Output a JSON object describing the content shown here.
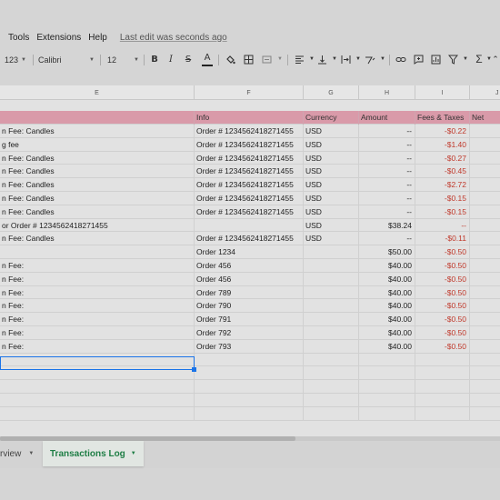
{
  "menu": {
    "items": [
      "Tools",
      "Extensions",
      "Help"
    ],
    "last_edit": "Last edit was seconds ago"
  },
  "toolbar": {
    "number_format": "123",
    "font": "Calibri",
    "font_size": "12",
    "icons": [
      "bold",
      "italic",
      "strikethrough",
      "text-color",
      "fill-color",
      "borders",
      "merge-cells",
      "align-horizontal",
      "align-vertical",
      "text-wrap",
      "text-rotation",
      "insert-link",
      "insert-comment",
      "insert-chart",
      "filter",
      "functions",
      "collapse"
    ]
  },
  "columns": [
    "E",
    "F",
    "G",
    "H",
    "I",
    "J"
  ],
  "header": {
    "e": "",
    "f": "Info",
    "g": "Currency",
    "h": "Amount",
    "i": "Fees & Taxes",
    "j": "Net"
  },
  "rows": [
    {
      "e": "n Fee: Candles",
      "f": "Order # 1234562418271455",
      "g": "USD",
      "h": "--",
      "i": "-$0.22"
    },
    {
      "e": "g fee",
      "f": "Order # 1234562418271455",
      "g": "USD",
      "h": "--",
      "i": "-$1.40"
    },
    {
      "e": "n Fee: Candles",
      "f": "Order # 1234562418271455",
      "g": "USD",
      "h": "--",
      "i": "-$0.27"
    },
    {
      "e": "n Fee: Candles",
      "f": "Order # 1234562418271455",
      "g": "USD",
      "h": "--",
      "i": "-$0.45"
    },
    {
      "e": "n Fee: Candles",
      "f": "Order # 1234562418271455",
      "g": "USD",
      "h": "--",
      "i": "-$2.72"
    },
    {
      "e": "n Fee: Candles",
      "f": "Order # 1234562418271455",
      "g": "USD",
      "h": "--",
      "i": "-$0.15"
    },
    {
      "e": "n Fee: Candles",
      "f": "Order # 1234562418271455",
      "g": "USD",
      "h": "--",
      "i": "-$0.15"
    },
    {
      "e": "or Order # 1234562418271455",
      "f": "",
      "g": "USD",
      "h": "$38.24",
      "i": "--"
    },
    {
      "e": "n Fee: Candles",
      "f": "Order # 1234562418271455",
      "g": "USD",
      "h": "--",
      "i": "-$0.11"
    },
    {
      "e": "",
      "f": "Order 1234",
      "g": "",
      "h": "$50.00",
      "i": "-$0.50"
    },
    {
      "e": "n Fee:",
      "f": "Order 456",
      "g": "",
      "h": "$40.00",
      "i": "-$0.50"
    },
    {
      "e": "n Fee:",
      "f": "Order 456",
      "g": "",
      "h": "$40.00",
      "i": "-$0.50"
    },
    {
      "e": "n Fee:",
      "f": "Order 789",
      "g": "",
      "h": "$40.00",
      "i": "-$0.50"
    },
    {
      "e": "n Fee:",
      "f": "Order 790",
      "g": "",
      "h": "$40.00",
      "i": "-$0.50"
    },
    {
      "e": "n Fee:",
      "f": "Order 791",
      "g": "",
      "h": "$40.00",
      "i": "-$0.50"
    },
    {
      "e": "n Fee:",
      "f": "Order 792",
      "g": "",
      "h": "$40.00",
      "i": "-$0.50"
    },
    {
      "e": "n Fee:",
      "f": "Order 793",
      "g": "",
      "h": "$40.00",
      "i": "-$0.50"
    }
  ],
  "sheet_tabs": [
    {
      "label": "rview",
      "active": false
    },
    {
      "label": "Transactions Log",
      "active": true
    }
  ],
  "colors": {
    "header_fill": "#d99aa9",
    "negative_text": "#c0392b",
    "selection": "#1a73e8",
    "active_tab_text": "#1e7e45"
  }
}
